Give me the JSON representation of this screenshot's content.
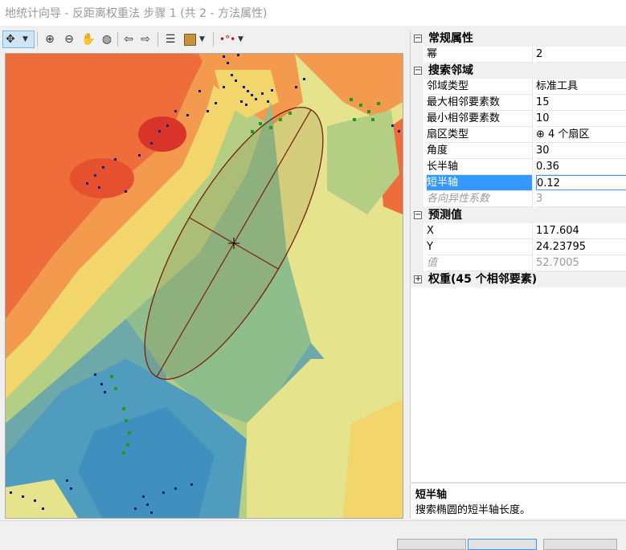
{
  "window": {
    "title": "地统计向导 - 反距离权重法 步骤 1 (共 2 - 方法属性)"
  },
  "toolbar": {
    "icons": [
      "pan-cursor-icon",
      "dropdown-icon",
      "zoom-in-icon",
      "zoom-out-icon",
      "hand-icon",
      "globe-icon",
      "back-icon",
      "forward-icon",
      "list-icon",
      "layer-icon",
      "dropdown-icon",
      "points-icon",
      "dropdown-icon"
    ]
  },
  "map": {
    "colors": {
      "red": "#d9342a",
      "orange": "#ee6d3a",
      "lightorange": "#f39a4e",
      "yellow": "#f2d56b",
      "lightyellow": "#e6e38d",
      "lightgreen": "#b4cf84",
      "green": "#8fbe8d",
      "teal": "#72afa7",
      "blue": "#4f9cbf"
    },
    "ellipse_color": "#7a1f10",
    "point_color_blue": "#0d1c8a",
    "point_color_green": "#19a019"
  },
  "properties": {
    "general": {
      "label": "常规属性",
      "rows": [
        {
          "key": "幂",
          "value": "2"
        }
      ]
    },
    "search": {
      "label": "搜索邻域",
      "rows": [
        {
          "key": "邻域类型",
          "value": "标准工具"
        },
        {
          "key": "最大相邻要素数",
          "value": "15"
        },
        {
          "key": "最小相邻要素数",
          "value": "10"
        },
        {
          "key": "扇区类型",
          "value": "⊕ 4 个扇区"
        },
        {
          "key": "角度",
          "value": "30"
        },
        {
          "key": "长半轴",
          "value": "0.36"
        },
        {
          "key": "短半轴",
          "value": "0.12"
        },
        {
          "key": "各向异性系数",
          "value": "3"
        }
      ]
    },
    "predicted": {
      "label": "预测值",
      "rows": [
        {
          "key": "X",
          "value": "117.604"
        },
        {
          "key": "Y",
          "value": "24.23795"
        },
        {
          "key": "值",
          "value": "52.7005"
        }
      ]
    },
    "weights": {
      "label": "权重(45 个相邻要素)"
    }
  },
  "description": {
    "title": "短半轴",
    "text": "搜索椭圆的短半轴长度。"
  }
}
